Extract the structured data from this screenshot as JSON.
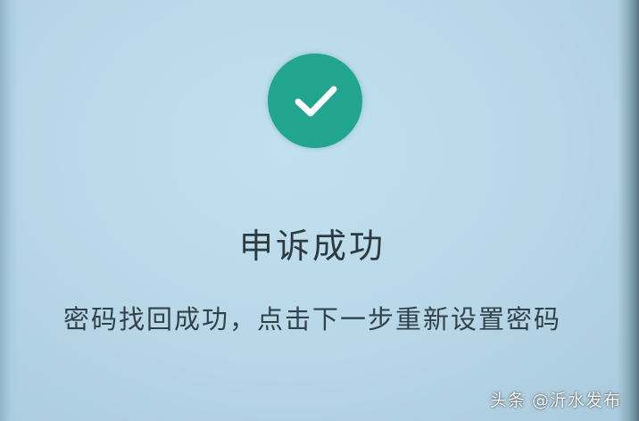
{
  "status": {
    "icon": "checkmark-icon",
    "title": "申诉成功",
    "message": "密码找回成功，点击下一步重新设置密码"
  },
  "watermark": "头条 @沂水发布",
  "colors": {
    "background": "#b6d5e6",
    "success": "#21a58f",
    "text": "#2d3a40"
  }
}
